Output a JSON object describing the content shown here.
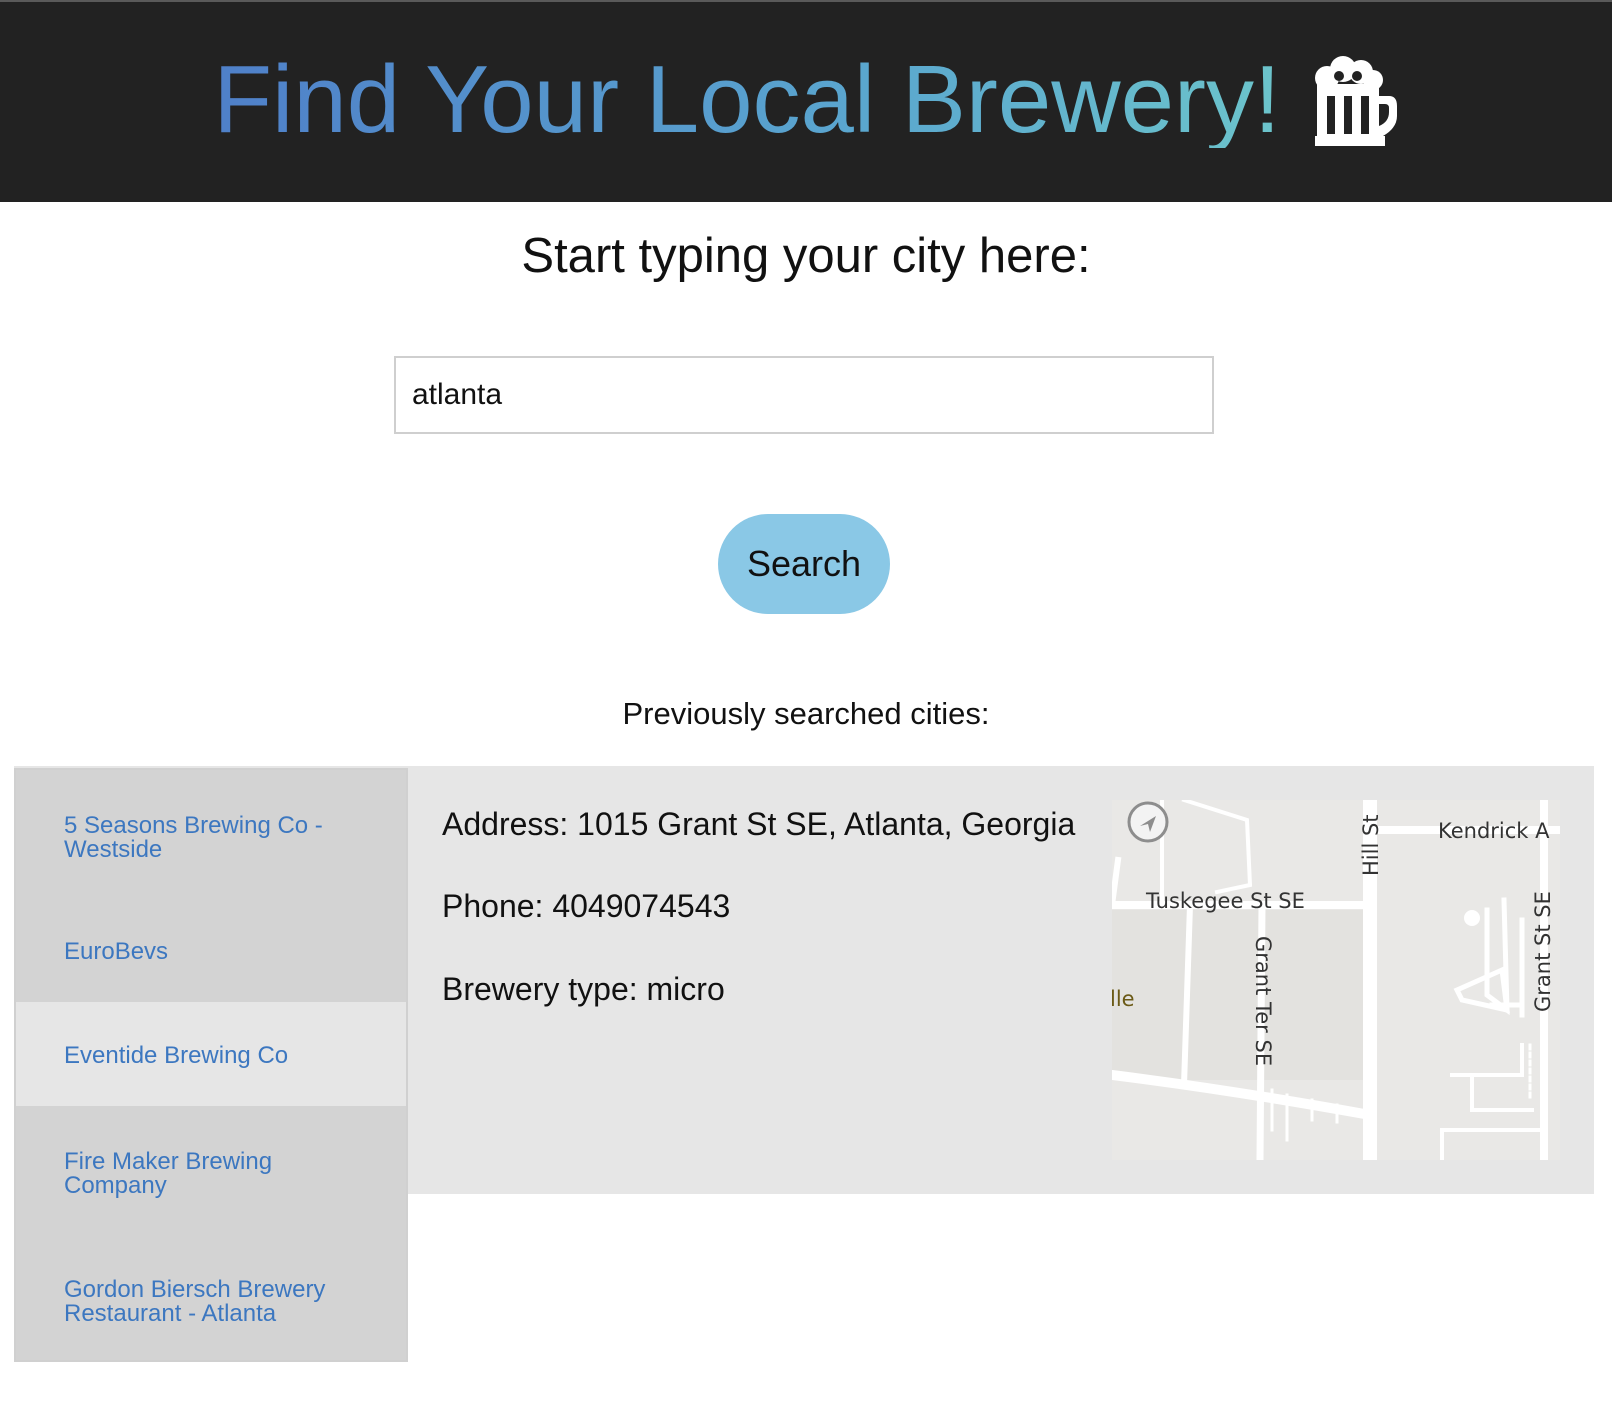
{
  "header": {
    "title": "Find Your Local Brewery!",
    "icon": "beer-mug-icon",
    "background": "#222222",
    "title_gradient": [
      "#4f80c9",
      "#6cc4cb"
    ]
  },
  "search": {
    "prompt": "Start typing your city here:",
    "value": "atlanta",
    "button_label": "Search",
    "button_color": "#8ac8e6"
  },
  "history": {
    "label": "Previously searched cities:"
  },
  "breweries": [
    {
      "name": "5 Seasons Brewing Co - Westside",
      "active": false
    },
    {
      "name": "EuroBevs",
      "active": false
    },
    {
      "name": "Eventide Brewing Co",
      "active": true
    },
    {
      "name": "Fire Maker Brewing Company",
      "active": false
    },
    {
      "name": "Gordon Biersch Brewery Restaurant - Atlanta",
      "active": false
    }
  ],
  "details": {
    "address": "Address: 1015 Grant St SE, Atlanta, Georgia",
    "phone": "Phone: 4049074543",
    "type": "Brewery type: micro"
  },
  "map": {
    "labels": {
      "hill": "Hill St",
      "kendrick": "Kendrick A",
      "tuskegee": "Tuskegee St SE",
      "grant_ter": "Grant Ter SE",
      "grant_st": "Grant St SE",
      "ille": "lle"
    },
    "link_color": "#3c77c0"
  }
}
